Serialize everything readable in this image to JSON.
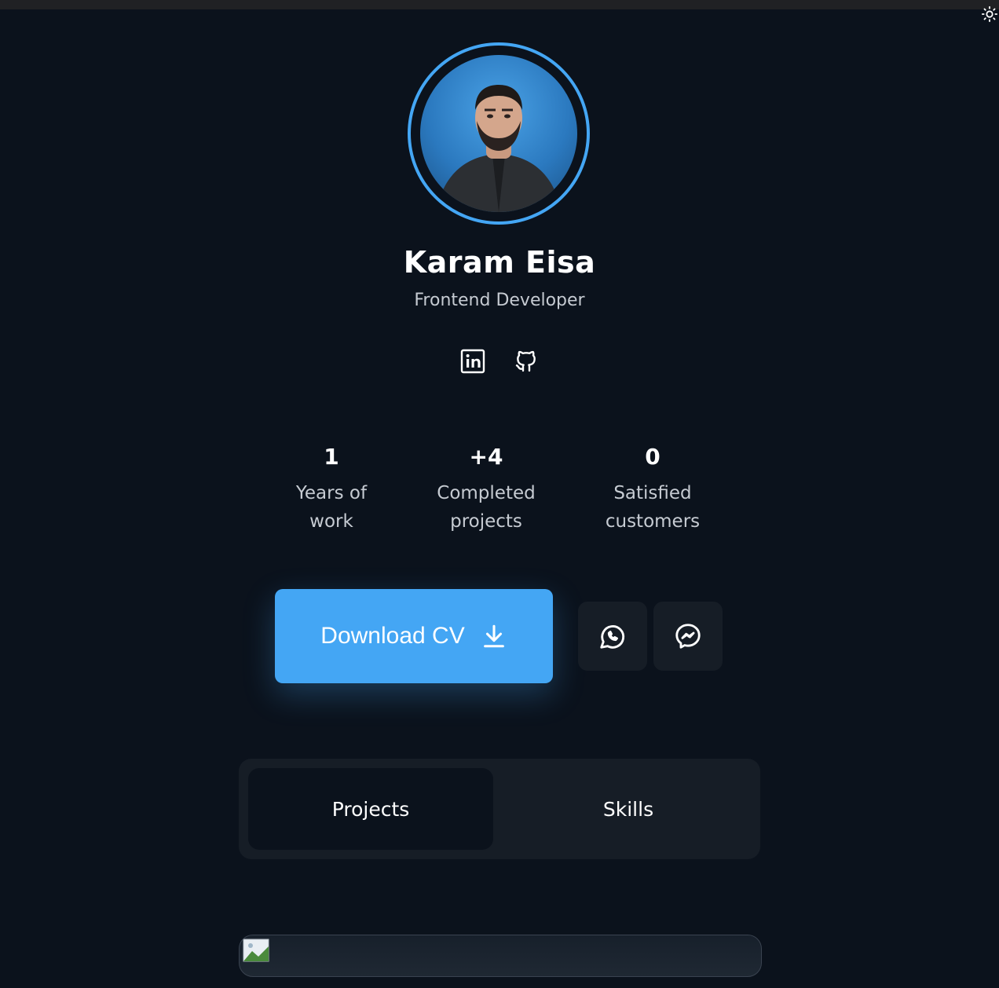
{
  "profile": {
    "name": "Karam Eisa",
    "role": "Frontend Developer"
  },
  "socials": [
    {
      "icon": "linkedin-icon"
    },
    {
      "icon": "github-icon"
    }
  ],
  "stats": [
    {
      "value": "1",
      "label_line1": "Years of",
      "label_line2": "work"
    },
    {
      "value": "+4",
      "label_line1": "Completed",
      "label_line2": "projects"
    },
    {
      "value": "0",
      "label_line1": "Satisfied",
      "label_line2": "customers"
    }
  ],
  "actions": {
    "download_label": "Download CV",
    "whatsapp_icon": "whatsapp-icon",
    "messenger_icon": "messenger-icon"
  },
  "tabs": [
    {
      "label": "Projects",
      "active": true
    },
    {
      "label": "Skills",
      "active": false
    }
  ],
  "colors": {
    "background": "#0b121c",
    "accent": "#44a6f4",
    "surface": "#161d26",
    "muted_text": "#c6cbd2"
  }
}
